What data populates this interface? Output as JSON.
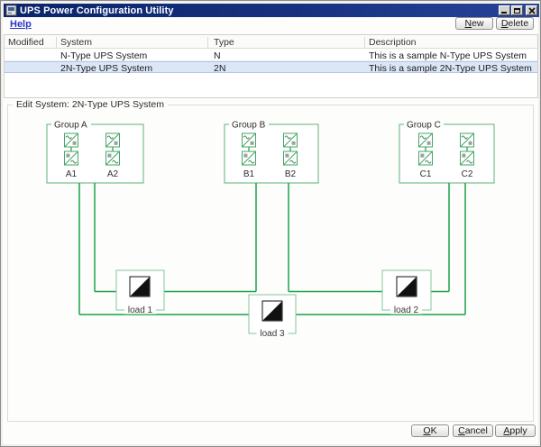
{
  "window": {
    "title": "UPS Power Configuration Utility"
  },
  "toolbar": {
    "help_label": "Help",
    "new_label": "New",
    "delete_label": "Delete"
  },
  "table": {
    "columns": [
      "Modified",
      "System",
      "Type",
      "Description"
    ],
    "rows": [
      {
        "modified": "",
        "system": "N-Type UPS System",
        "type": "N",
        "description": "This is a sample N-Type UPS System",
        "selected": false
      },
      {
        "modified": "",
        "system": "2N-Type UPS System",
        "type": "2N",
        "description": "This is a sample 2N-Type UPS System",
        "selected": true
      }
    ]
  },
  "edit_panel": {
    "legend": "Edit System: 2N-Type UPS System",
    "groups": [
      {
        "name": "Group A",
        "units": [
          "A1",
          "A2"
        ]
      },
      {
        "name": "Group B",
        "units": [
          "B1",
          "B2"
        ]
      },
      {
        "name": "Group C",
        "units": [
          "C1",
          "C2"
        ]
      }
    ],
    "loads": [
      "load 1",
      "load 2",
      "load 3"
    ],
    "connections": [
      {
        "load": "load 1",
        "sources": [
          "A2",
          "B1"
        ]
      },
      {
        "load": "load 2",
        "sources": [
          "B2",
          "C1"
        ]
      },
      {
        "load": "load 3",
        "sources": [
          "A1",
          "C2"
        ]
      }
    ]
  },
  "footer": {
    "ok_label": "OK",
    "cancel_label": "Cancel",
    "apply_label": "Apply"
  },
  "colors": {
    "titlebar_blue": "#0a246a",
    "selection_blue": "#dbe6f7",
    "wire_green": "#1aa24d",
    "group_border_green": "#5bb27a",
    "load_border_green": "#82c79a",
    "unit_border_green": "#43a666"
  }
}
